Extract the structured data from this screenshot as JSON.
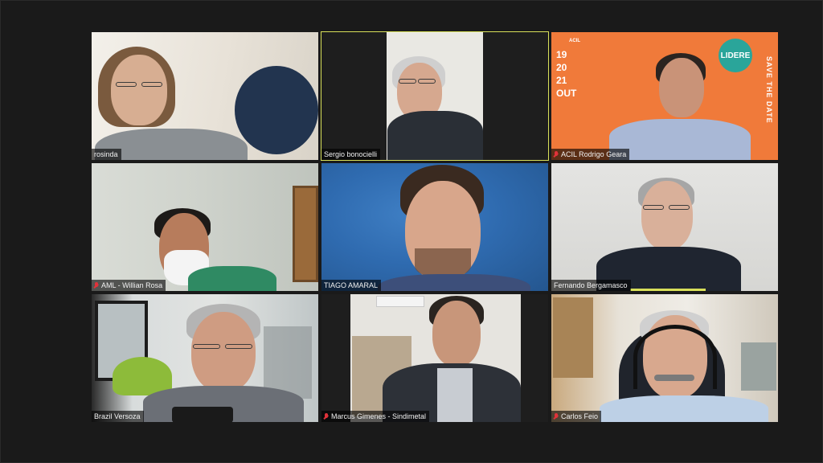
{
  "meeting": {
    "participants": [
      {
        "name": "rosinda",
        "muted": false,
        "active_speaker": false
      },
      {
        "name": "Sergio bonocielli",
        "muted": false,
        "active_speaker": true
      },
      {
        "name": "ACIL Rodrigo Geara",
        "muted": true,
        "active_speaker": false
      },
      {
        "name": "AML - Willian Rosa",
        "muted": true,
        "active_speaker": false
      },
      {
        "name": "TIAGO AMARAL",
        "muted": false,
        "active_speaker": false
      },
      {
        "name": "Fernando Bergamasco",
        "muted": false,
        "active_speaker": false
      },
      {
        "name": "Brazil Versoza",
        "muted": false,
        "active_speaker": false
      },
      {
        "name": "Marcus Gimenes - Sindimetal",
        "muted": true,
        "active_speaker": false
      },
      {
        "name": "Carlos Feio",
        "muted": true,
        "active_speaker": false
      }
    ]
  },
  "background_banner": {
    "acil": "ACIL",
    "dates": [
      "19",
      "20",
      "21",
      "OUT"
    ],
    "lidere": "LIDERE",
    "save_the_date": "SAVE THE DATE"
  },
  "colors": {
    "active_border": "#d8e05a",
    "muted_icon": "#e0323a",
    "banner_orange": "#f07a3a"
  },
  "icons": {
    "mute": "mic-muted-icon"
  }
}
